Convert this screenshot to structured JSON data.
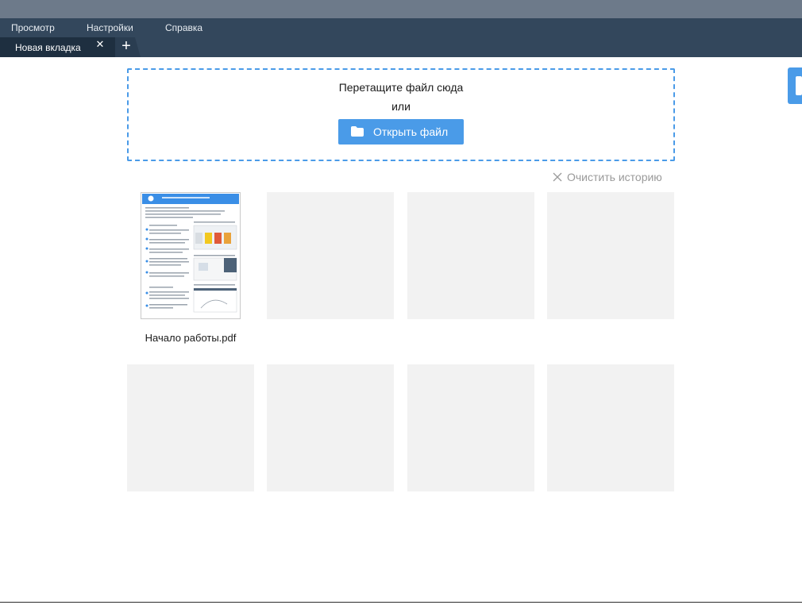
{
  "menu": {
    "items": [
      {
        "label": "Просмотр"
      },
      {
        "label": "Настройки"
      },
      {
        "label": "Справка"
      }
    ]
  },
  "tabs": {
    "active_label": "Новая вкладка",
    "close_glyph": "✕",
    "add_glyph": "+"
  },
  "dropzone": {
    "line1": "Перетащите файл сюда",
    "line2": "или",
    "open_button_label": "Открыть файл",
    "open_button_icon": "folder-icon"
  },
  "history": {
    "clear_label": "Очистить историю",
    "recent_files": [
      {
        "name": "Начало работы.pdf"
      }
    ]
  },
  "colors": {
    "accent": "#4a9be8",
    "menubar": "#33475c",
    "titlebar": "#6d7a8a",
    "tile_placeholder": "#f2f2f2"
  }
}
